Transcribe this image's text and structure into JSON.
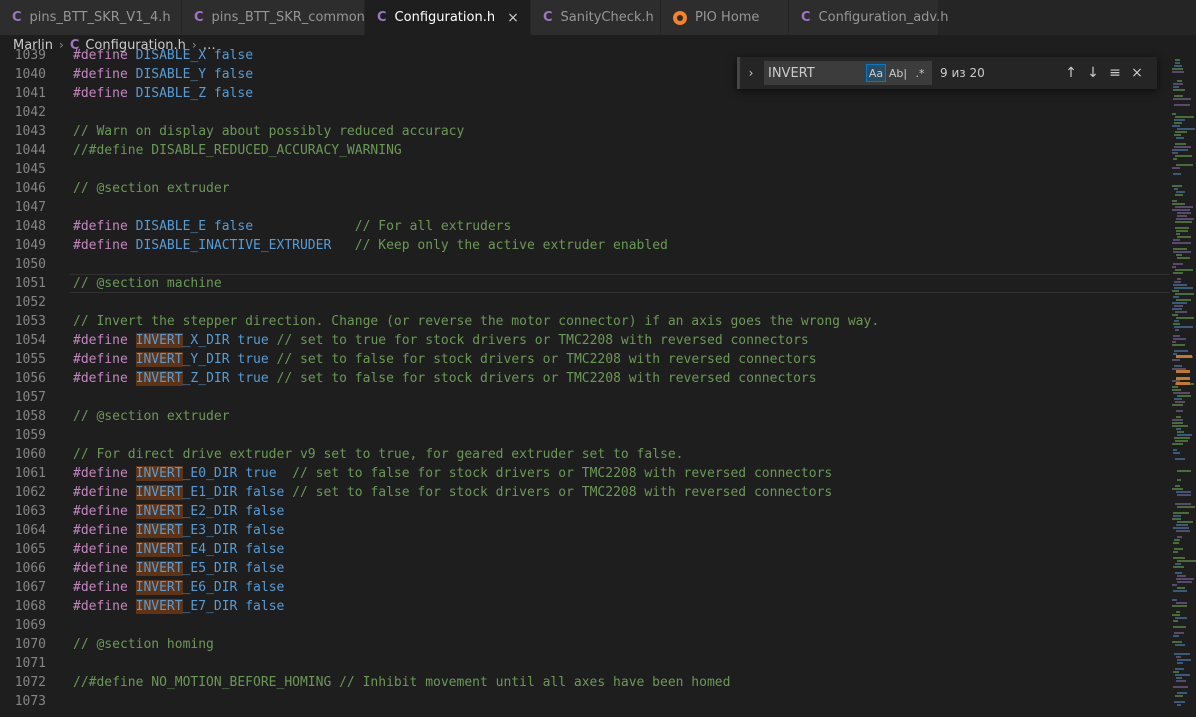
{
  "tabs": [
    {
      "icon": "C",
      "label": "pins_BTT_SKR_V1_4.h",
      "active": false
    },
    {
      "icon": "C",
      "label": "pins_BTT_SKR_common.h",
      "active": false
    },
    {
      "icon": "C",
      "label": "Configuration.h",
      "active": true,
      "close": "×"
    },
    {
      "icon": "C",
      "label": "SanityCheck.h",
      "active": false
    },
    {
      "icon": "pio",
      "label": "PIO Home",
      "active": false
    },
    {
      "icon": "C",
      "label": "Configuration_adv.h",
      "active": false
    }
  ],
  "breadcrumb": {
    "folder": "Marlin",
    "file_icon": "C",
    "file": "Configuration.h",
    "more": "…"
  },
  "find": {
    "toggle": "›",
    "value": "INVERT",
    "match_case": "Aa",
    "whole_word": "Ab|",
    "regex": ".*",
    "count": "9 из 20",
    "prev": "↑",
    "next": "↓",
    "selection": "≡",
    "close": "×"
  },
  "colors": {
    "keyword": "#c586c0",
    "macro": "#569cd6",
    "comment": "#6a9955",
    "match_highlight": "#613315"
  },
  "lines": [
    {
      "num": "1039",
      "code": "#define DISABLE_X false"
    },
    {
      "num": "1040",
      "code": "#define DISABLE_Y false"
    },
    {
      "num": "1041",
      "code": "#define DISABLE_Z false"
    },
    {
      "num": "1042",
      "code": ""
    },
    {
      "num": "1043",
      "code": "// Warn on display about possibly reduced accuracy"
    },
    {
      "num": "1044",
      "code": "//#define DISABLE_REDUCED_ACCURACY_WARNING"
    },
    {
      "num": "1045",
      "code": ""
    },
    {
      "num": "1046",
      "code": "// @section extruder"
    },
    {
      "num": "1047",
      "code": ""
    },
    {
      "num": "1048",
      "code": "#define DISABLE_E false             // For all extruders"
    },
    {
      "num": "1049",
      "code": "#define DISABLE_INACTIVE_EXTRUDER   // Keep only the active extruder enabled"
    },
    {
      "num": "1050",
      "code": ""
    },
    {
      "num": "1051",
      "code": "// @section machine"
    },
    {
      "num": "1052",
      "code": ""
    },
    {
      "num": "1053",
      "code": "// Invert the stepper direction. Change (or reverse the motor connector) if an axis goes the wrong way."
    },
    {
      "num": "1054",
      "code": "#define INVERT_X_DIR true // set to true for stock drivers or TMC2208 with reversed connectors"
    },
    {
      "num": "1055",
      "code": "#define INVERT_Y_DIR true // set to false for stock drivers or TMC2208 with reversed connectors"
    },
    {
      "num": "1056",
      "code": "#define INVERT_Z_DIR true // set to false for stock drivers or TMC2208 with reversed connectors"
    },
    {
      "num": "1057",
      "code": ""
    },
    {
      "num": "1058",
      "code": "// @section extruder"
    },
    {
      "num": "1059",
      "code": ""
    },
    {
      "num": "1060",
      "code": "// For direct drive extruder v9 set to true, for geared extruder set to false."
    },
    {
      "num": "1061",
      "code": "#define INVERT_E0_DIR true  // set to false for stock drivers or TMC2208 with reversed connectors"
    },
    {
      "num": "1062",
      "code": "#define INVERT_E1_DIR false // set to false for stock drivers or TMC2208 with reversed connectors"
    },
    {
      "num": "1063",
      "code": "#define INVERT_E2_DIR false"
    },
    {
      "num": "1064",
      "code": "#define INVERT_E3_DIR false"
    },
    {
      "num": "1065",
      "code": "#define INVERT_E4_DIR false"
    },
    {
      "num": "1066",
      "code": "#define INVERT_E5_DIR false"
    },
    {
      "num": "1067",
      "code": "#define INVERT_E6_DIR false"
    },
    {
      "num": "1068",
      "code": "#define INVERT_E7_DIR false"
    },
    {
      "num": "1069",
      "code": ""
    },
    {
      "num": "1070",
      "code": "// @section homing"
    },
    {
      "num": "1071",
      "code": ""
    },
    {
      "num": "1072",
      "code": "//#define NO_MOTION_BEFORE_HOMING // Inhibit movement until all axes have been homed"
    },
    {
      "num": "1073",
      "code": ""
    }
  ],
  "current_line": "1051"
}
